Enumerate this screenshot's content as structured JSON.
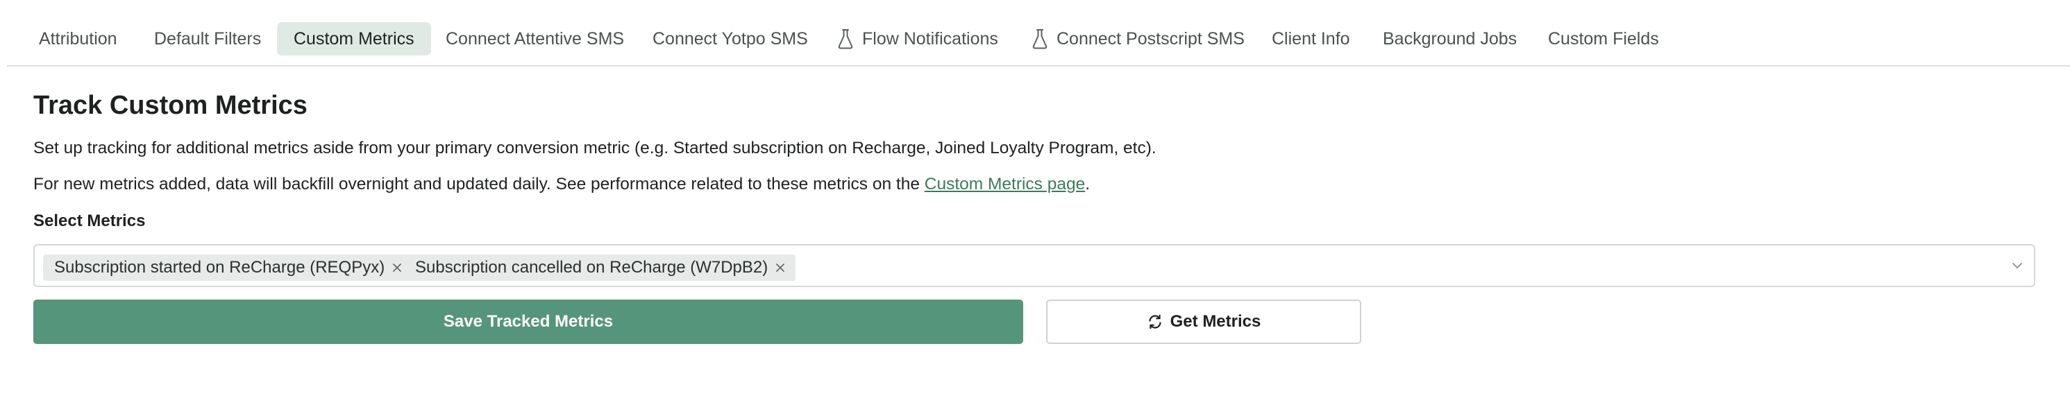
{
  "tabs": [
    {
      "label": "Attribution",
      "icon": null
    },
    {
      "label": "Default Filters",
      "icon": null
    },
    {
      "label": "Custom Metrics",
      "icon": null,
      "active": true
    },
    {
      "label": "Connect Attentive SMS",
      "icon": null
    },
    {
      "label": "Connect Yotpo SMS",
      "icon": null
    },
    {
      "label": "Flow Notifications",
      "icon": "flask-icon"
    },
    {
      "label": "Connect Postscript SMS",
      "icon": "flask-icon"
    },
    {
      "label": "Client Info",
      "icon": null
    },
    {
      "label": "Background Jobs",
      "icon": null
    },
    {
      "label": "Custom Fields",
      "icon": null
    }
  ],
  "main": {
    "title": "Track Custom Metrics",
    "description_1": "Set up tracking for additional metrics aside from your primary conversion metric (e.g. Started subscription on Recharge, Joined Loyalty Program, etc).",
    "description_2_before": "For new metrics added, data will backfill overnight and updated daily. See performance related to these metrics on the ",
    "description_2_link": "Custom Metrics page",
    "description_2_after": ".",
    "select_label": "Select Metrics",
    "selected_metrics": [
      "Subscription started on ReCharge (REQPyx)",
      "Subscription cancelled on ReCharge (W7DpB2)"
    ],
    "save_button": "Save Tracked Metrics",
    "get_metrics_button": "Get Metrics"
  },
  "colors": {
    "accent": "#55957b",
    "active_tab_bg": "#dfeae4",
    "link": "#3d7a5a"
  }
}
